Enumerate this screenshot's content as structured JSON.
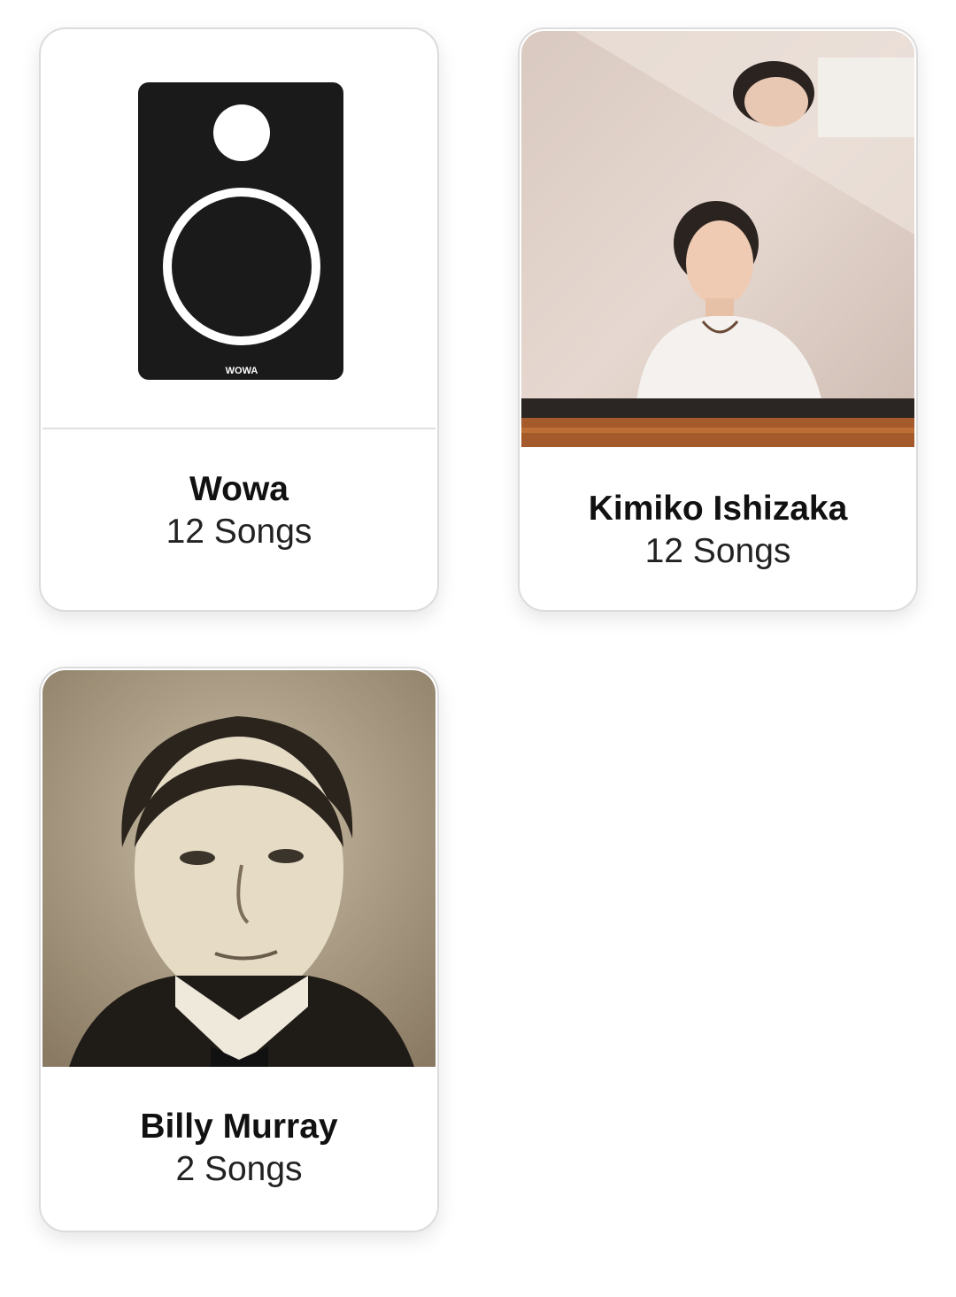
{
  "artists": [
    {
      "name": "Wowa",
      "count": "12 Songs",
      "image": "speaker-logo",
      "logo_text": "WOWA"
    },
    {
      "name": "Kimiko Ishizaka",
      "count": "12 Songs",
      "image": "pianist-photo"
    },
    {
      "name": "Billy Murray",
      "count": "2 Songs",
      "image": "vintage-portrait-photo"
    }
  ],
  "colors": {
    "card_border": "#dcdcdc",
    "speaker_body": "#1a1a1a",
    "sepia": "#9c8b73"
  }
}
